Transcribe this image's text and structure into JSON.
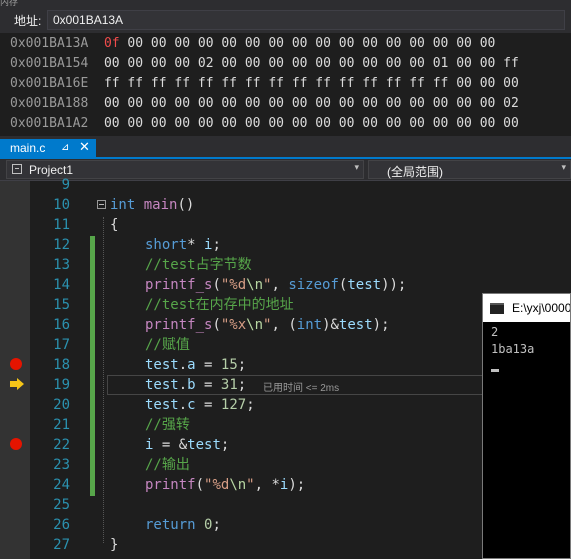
{
  "window": {
    "partial_title": "内存"
  },
  "address_bar": {
    "label": "地址:",
    "value": "0x001BA13A"
  },
  "memory_rows": [
    {
      "addr": "0x001BA13A",
      "bytes": [
        "0f",
        "00",
        "00",
        "00",
        "00",
        "00",
        "00",
        "00",
        "00",
        "00",
        "00",
        "00",
        "00",
        "00",
        "00",
        "00",
        "00"
      ]
    },
    {
      "addr": "0x001BA154",
      "bytes": [
        "00",
        "00",
        "00",
        "00",
        "02",
        "00",
        "00",
        "00",
        "00",
        "00",
        "00",
        "00",
        "00",
        "00",
        "01",
        "00",
        "00",
        "ff"
      ]
    },
    {
      "addr": "0x001BA16E",
      "bytes": [
        "ff",
        "ff",
        "ff",
        "ff",
        "ff",
        "ff",
        "ff",
        "ff",
        "ff",
        "ff",
        "ff",
        "ff",
        "ff",
        "ff",
        "ff",
        "00",
        "00",
        "00"
      ]
    },
    {
      "addr": "0x001BA188",
      "bytes": [
        "00",
        "00",
        "00",
        "00",
        "00",
        "00",
        "00",
        "00",
        "00",
        "00",
        "00",
        "00",
        "00",
        "00",
        "00",
        "00",
        "00",
        "02"
      ]
    },
    {
      "addr": "0x001BA1A2",
      "bytes": [
        "00",
        "00",
        "00",
        "00",
        "00",
        "00",
        "00",
        "00",
        "00",
        "00",
        "00",
        "00",
        "00",
        "00",
        "00",
        "00",
        "00",
        "00"
      ]
    }
  ],
  "tab": {
    "label": "main.c",
    "pin": "⊿",
    "close": "✕"
  },
  "nav": {
    "project": "Project1",
    "scope": "(全局范围)",
    "arrow": "▾"
  },
  "line_numbers": [
    "9",
    "10",
    "11",
    "12",
    "13",
    "14",
    "15",
    "16",
    "17",
    "18",
    "19",
    "20",
    "21",
    "22",
    "23",
    "24",
    "25",
    "26",
    "27"
  ],
  "code_lines": {
    "l10": {
      "kw": "int",
      "fn": "main",
      "rest": "()"
    },
    "l11": "{",
    "l12": {
      "kw": "short",
      "rest": "* ",
      "var": "i",
      "end": ";"
    },
    "l13": "//test占字节数",
    "l14": {
      "fn": "printf_s",
      "p1": "(",
      "s1": "\"%d",
      "esc": "\\n",
      "s2": "\"",
      "p2": ", ",
      "kw": "sizeof",
      "p3": "(",
      "var": "test",
      "p4": "));"
    },
    "l15": "//test在内存中的地址",
    "l16": {
      "fn": "printf_s",
      "p1": "(",
      "s1": "\"%x",
      "esc": "\\n",
      "s2": "\"",
      "p2": ", (",
      "kw": "int",
      "p3": ")&",
      "var": "test",
      "p4": ");"
    },
    "l17": "//赋值",
    "l18": {
      "var": "test",
      "dot": ".",
      "mem": "a",
      "rest": " = ",
      "num": "15",
      "end": ";"
    },
    "l19": {
      "var": "test",
      "dot": ".",
      "mem": "b",
      "rest": " = ",
      "num": "31",
      "end": ";"
    },
    "l20": {
      "var": "test",
      "dot": ".",
      "mem": "c",
      "rest": " = ",
      "num": "127",
      "end": ";"
    },
    "l21": "//强转",
    "l22": {
      "var": "i",
      "rest": " = &",
      "var2": "test",
      "end": ";"
    },
    "l23": "//输出",
    "l24": {
      "fn": "printf",
      "p1": "(",
      "s1": "\"%d",
      "esc": "\\n",
      "s2": "\"",
      "p2": ", *",
      "var": "i",
      "p3": ");"
    },
    "l26": {
      "kw": "return",
      "rest": " ",
      "num": "0",
      "end": ";"
    },
    "l27": "}"
  },
  "perf_tip": "已用时间 <= 2ms",
  "console": {
    "title": "E:\\yxj\\0000",
    "lines": [
      "2",
      "1ba13a"
    ]
  },
  "colors": {
    "accent": "#007acc",
    "breakpoint": "#e51400",
    "exec_arrow": "#f5c518"
  }
}
